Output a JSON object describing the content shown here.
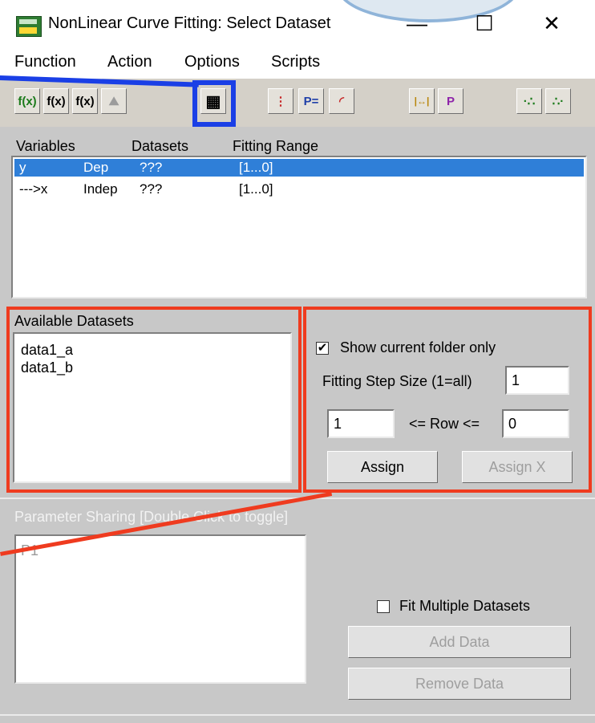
{
  "window": {
    "title": "NonLinear Curve Fitting: Select Dataset"
  },
  "title_controls": {
    "minimize": "—",
    "maximize": "☐",
    "close": "✕"
  },
  "menu": {
    "function": "Function",
    "action": "Action",
    "options": "Options",
    "scripts": "Scripts"
  },
  "toolbar": {
    "fx_check": "f(x)",
    "fx_edit": "f(x)",
    "fx_def": "f(x)",
    "peaks": "⛰",
    "select_dataset": "▦",
    "traffic": "⋮",
    "params": "P=",
    "simulate": "◜",
    "range": "|↔|",
    "fit_param": "P",
    "fit": "·∴",
    "fit_all": "∴·"
  },
  "variables": {
    "headers": {
      "variables": "Variables",
      "datasets": "Datasets",
      "range": "Fitting Range"
    },
    "rows": [
      {
        "var": "y",
        "type": "Dep",
        "dataset": "???",
        "range": "[1...0]"
      },
      {
        "var": "--->x",
        "type": "Indep",
        "dataset": "???",
        "range": "[1...0]"
      }
    ]
  },
  "available": {
    "label": "Available Datasets",
    "items": [
      "data1_a",
      "data1_b"
    ]
  },
  "options_panel": {
    "show_current_folder": "Show current folder only",
    "step_label": "Fitting Step Size (1=all)",
    "step_value": "1",
    "row_from": "1",
    "row_label": "<= Row <=",
    "row_to": "0",
    "assign": "Assign",
    "assign_x": "Assign X"
  },
  "sharing": {
    "label": "Parameter Sharing [Double Click to toggle]",
    "items": [
      "P1"
    ],
    "fit_multiple": "Fit Multiple Datasets",
    "add_data": "Add Data",
    "remove_data": "Remove Data"
  },
  "colors": {
    "highlight_box": "#1a3fe6",
    "annotation": "#ef3b1f",
    "selection": "#2f7fd8"
  }
}
